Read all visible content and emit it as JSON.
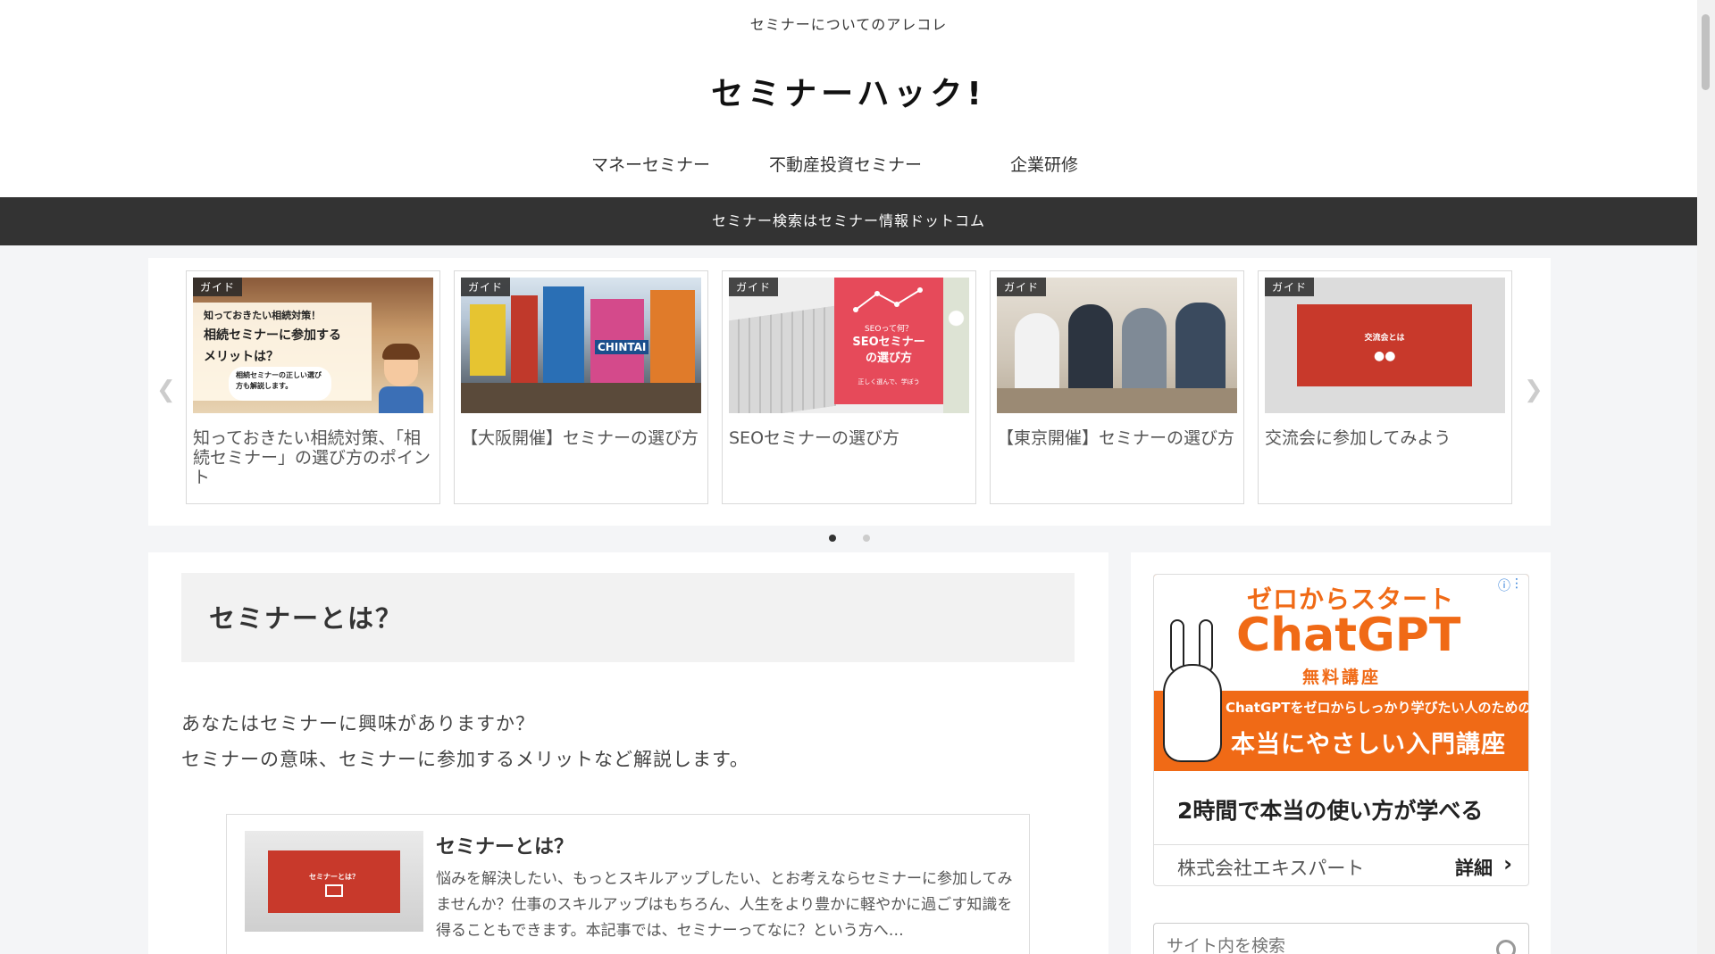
{
  "header": {
    "tagline": "セミナーについてのアレコレ",
    "logo": "セミナーハック!"
  },
  "nav": {
    "items": [
      {
        "label": "マネーセミナー"
      },
      {
        "label": "不動産投資セミナー"
      },
      {
        "label": "企業研修"
      }
    ]
  },
  "banner": {
    "text": "セミナー検索はセミナー情報ドットコム"
  },
  "carousel": {
    "cards": [
      {
        "category": "ガイド",
        "title": "知っておきたい相続対策、「相続セミナー」の選び方のポイント",
        "thumb_lines": [
          "知っておきたい相続対策！",
          "相続セミナーに参加する",
          "メリットは？"
        ],
        "thumb_bubble": "相続セミナーの正しい選び方も解説します。"
      },
      {
        "category": "ガイド",
        "title": "【大阪開催】セミナーの選び方",
        "thumb_sign": "CHINTAI"
      },
      {
        "category": "ガイド",
        "title": "SEOセミナーの選び方",
        "thumb_small": "SEOって何？",
        "thumb_big": "SEOセミナーの選び方",
        "thumb_tiny": "正しく選んで、学ぼう"
      },
      {
        "category": "ガイド",
        "title": "【東京開催】セミナーの選び方"
      },
      {
        "category": "ガイド",
        "title": "交流会に参加してみよう",
        "thumb_text": "交流会とは"
      }
    ],
    "active_page": 1,
    "page_count": 2
  },
  "article": {
    "title": "セミナーとは？",
    "intro": [
      "あなたはセミナーに興味がありますか？",
      "セミナーの意味、セミナーに参加するメリットなど解説します。"
    ],
    "blogcard": {
      "title": "セミナーとは？",
      "thumb_text": "セミナーとは？",
      "excerpt": "悩みを解決したい、もっとスキルアップしたい、とお考えならセミナーに参加してみませんか？仕事のスキルアップはもちろん、人生をより豊かに軽やかに過ごす知識を得ることもできます。本記事では、セミナーってなに？という方へ…"
    }
  },
  "ad": {
    "image_line1": "ゼロからスタート",
    "image_line2": "ChatGPT",
    "image_line3": "無料講座",
    "image_line4": "ChatGPTをゼロからしっかり学びたい人のための",
    "image_line5": "本当にやさしい入門講座",
    "headline": "2時間で本当の使い方が学べる",
    "advertiser": "株式会社エキスパート",
    "cta": "詳細",
    "info_icon": "ⓘ",
    "more_icon": "⋮"
  },
  "search": {
    "placeholder": "サイト内を検索"
  },
  "colors": {
    "banner_bg": "#333333",
    "ad_orange": "#f06a16",
    "thumb_red": "#c8392b",
    "seo_pink": "#e64a5a"
  }
}
